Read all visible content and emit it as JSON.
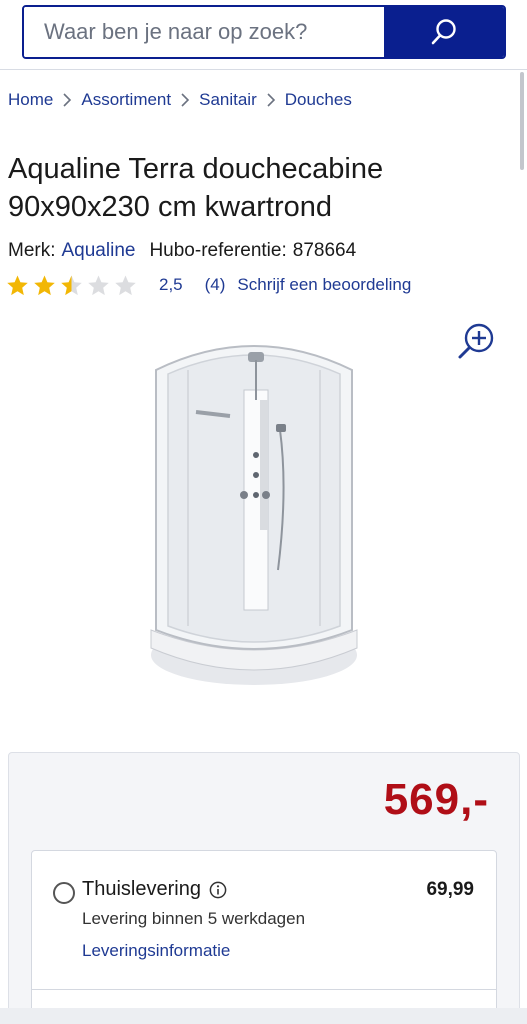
{
  "search": {
    "placeholder": "Waar ben je naar op zoek?",
    "icon": "search-icon"
  },
  "breadcrumb": [
    {
      "label": "Home"
    },
    {
      "label": "Assortiment"
    },
    {
      "label": "Sanitair"
    },
    {
      "label": "Douches"
    }
  ],
  "product": {
    "title": "Aqualine Terra douchecabine 90x90x230 cm kwartrond",
    "brand_label": "Merk:",
    "brand": "Aqualine",
    "reference_label": "Hubo-referentie:",
    "reference": "878664",
    "rating": {
      "value": 2.5,
      "max": 5,
      "value_text": "2,5",
      "count_text": "(4)",
      "review_link": "Schrijf een beoordeling"
    },
    "price": "569,-"
  },
  "delivery": {
    "option_label": "Thuislevering",
    "option_price": "69,99",
    "option_sub": "Levering binnen 5 werkdagen",
    "option_link": "Leveringsinformatie"
  },
  "colors": {
    "brand_blue": "#0a1f8f",
    "link_blue": "#1f3a93",
    "price_red": "#b00e17",
    "star_gold": "#f2b705",
    "star_empty": "#dcdde0"
  }
}
